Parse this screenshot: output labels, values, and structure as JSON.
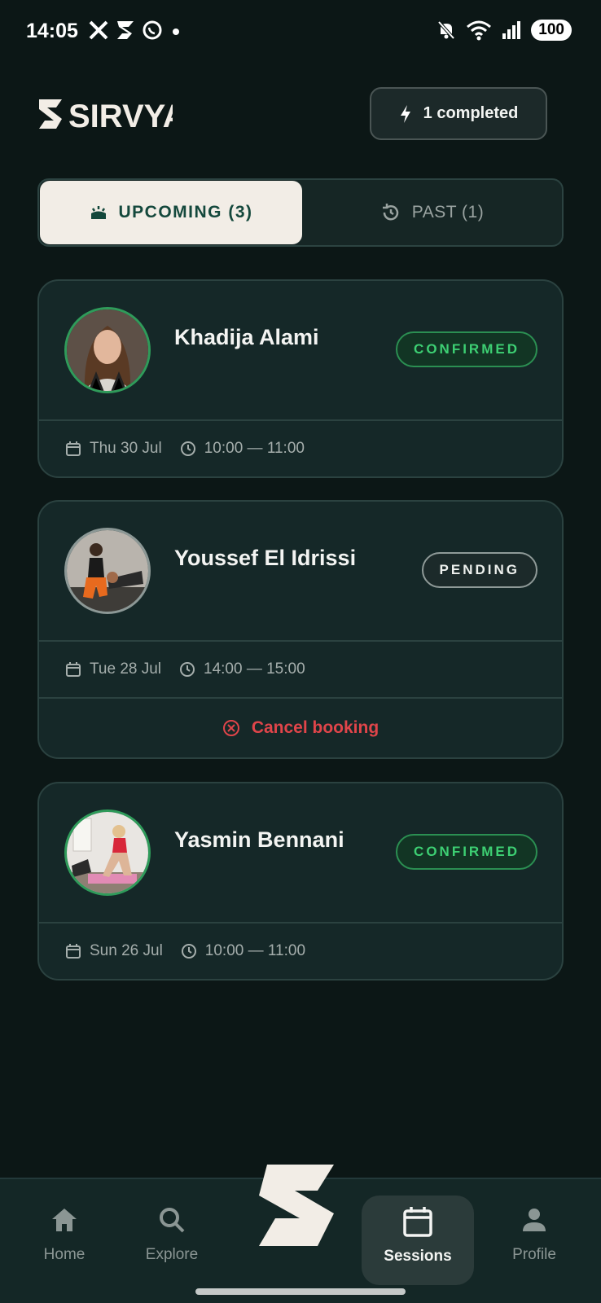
{
  "status_bar": {
    "time": "14:05",
    "battery": "100",
    "left_icons": [
      "x-icon",
      "sirvya-notification-icon",
      "whatsapp-icon",
      "dot-icon"
    ],
    "right_icons": [
      "mute-icon",
      "wifi-icon",
      "signal-icon"
    ]
  },
  "header": {
    "logo_text": "SIRVYA",
    "completed_label": "1 completed"
  },
  "tabs": {
    "upcoming": "UPCOMING (3)",
    "past": "PAST (1)"
  },
  "sessions": [
    {
      "coach": "Khadija Alami",
      "status": "CONFIRMED",
      "date": "Thu 30 Jul",
      "time": "10:00 — 11:00"
    },
    {
      "coach": "Youssef El Idrissi",
      "status": "PENDING",
      "date": "Tue 28 Jul",
      "time": "14:00 — 15:00",
      "action": "Cancel booking"
    },
    {
      "coach": "Yasmin Bennani",
      "status": "CONFIRMED",
      "date": "Sun 26 Jul",
      "time": "10:00 — 11:00"
    }
  ],
  "nav": {
    "home": "Home",
    "explore": "Explore",
    "sessions": "Sessions",
    "profile": "Profile"
  },
  "colors": {
    "background": "#0c1716",
    "card": "#152828",
    "confirmed": "#3dcf73",
    "cancel": "#e0454a",
    "active_tab": "#f2ede6"
  }
}
